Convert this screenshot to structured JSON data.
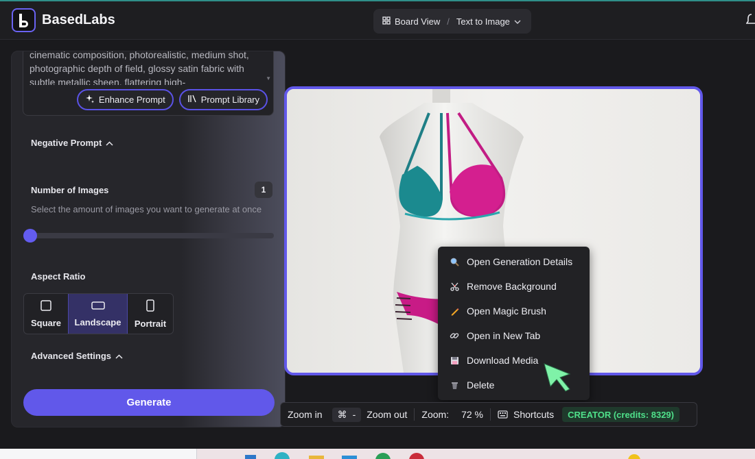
{
  "app": {
    "name": "BasedLabs"
  },
  "header": {
    "view_label": "Board View",
    "separator": "/",
    "mode_label": "Text to Image"
  },
  "prompt": {
    "text": "cinematic composition, photorealistic, medium shot, photographic depth of field, glossy satin fabric with subtle metallic sheen, flattering high-",
    "enhance_label": "Enhance Prompt",
    "library_label": "Prompt Library"
  },
  "negative_prompt": {
    "label": "Negative Prompt"
  },
  "num_images": {
    "label": "Number of Images",
    "value": "1",
    "hint": "Select the amount of images you want to generate at once",
    "slider_fraction": 0
  },
  "aspect_ratio": {
    "label": "Aspect Ratio",
    "options": [
      "Square",
      "Landscape",
      "Portrait"
    ],
    "selected": "Landscape"
  },
  "advanced": {
    "label": "Advanced Settings"
  },
  "generate_label": "Generate",
  "context_menu": {
    "items": [
      {
        "label": "Open Generation Details",
        "icon": "magnifier-icon"
      },
      {
        "label": "Remove Background",
        "icon": "scissors-icon"
      },
      {
        "label": "Open Magic Brush",
        "icon": "pencil-icon"
      },
      {
        "label": "Open in New Tab",
        "icon": "link-icon"
      },
      {
        "label": "Download Media",
        "icon": "floppy-disk-icon"
      },
      {
        "label": "Delete",
        "icon": "trash-icon"
      }
    ]
  },
  "toolbar": {
    "zoom_in": "Zoom in",
    "cmd_symbol": "⌘",
    "minus": "-",
    "zoom_out": "Zoom out",
    "zoom_label": "Zoom:",
    "zoom_value": "72 %",
    "shortcuts": "Shortcuts",
    "credits": "CREATOR (credits: 8329)"
  },
  "colors": {
    "accent": "#6158ea",
    "credit_text": "#4fe08a",
    "menu_bg": "#222225"
  }
}
